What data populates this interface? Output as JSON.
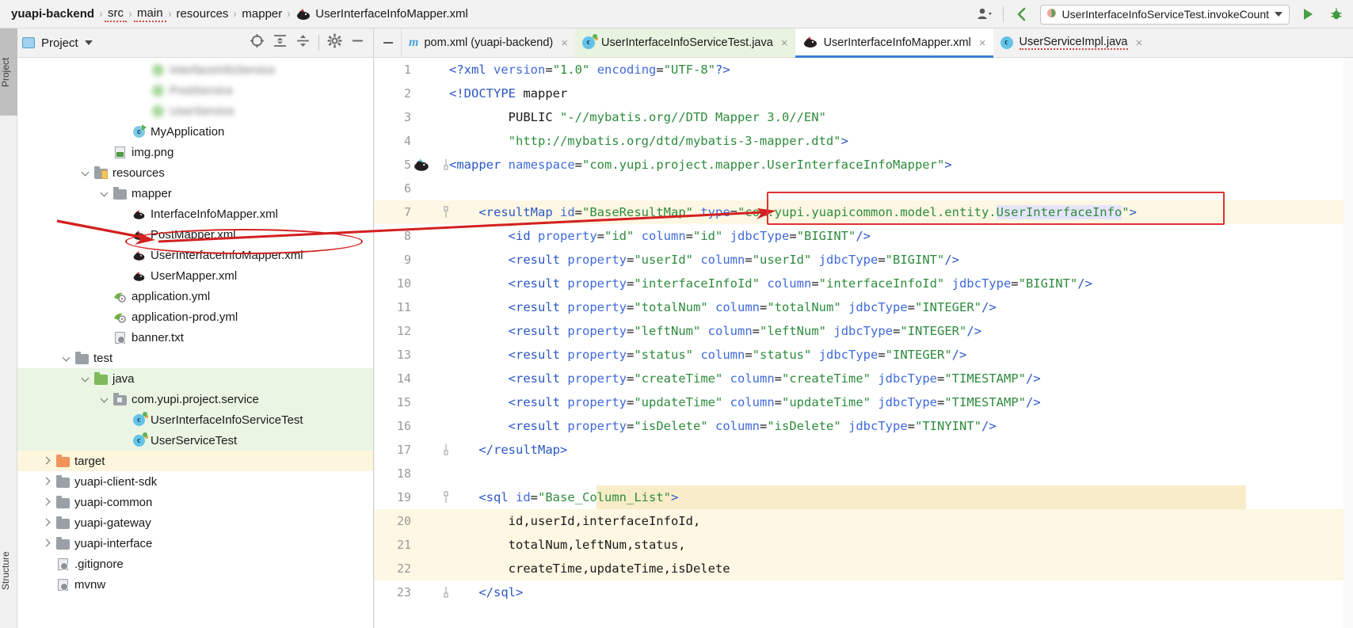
{
  "window": {
    "breadcrumb": [
      {
        "label": "yuapi-backend",
        "bold": true,
        "underline": false,
        "icon": null
      },
      {
        "label": "src",
        "bold": false,
        "underline": true,
        "icon": null
      },
      {
        "label": "main",
        "bold": false,
        "underline": true,
        "icon": null
      },
      {
        "label": "resources",
        "bold": false,
        "underline": false,
        "icon": null
      },
      {
        "label": "mapper",
        "bold": false,
        "underline": false,
        "icon": null
      },
      {
        "label": "UserInterfaceInfoMapper.xml",
        "bold": false,
        "underline": false,
        "icon": "mybatis-xml-icon"
      }
    ],
    "separator": "›",
    "toolbar_right": {
      "account_icon": "user-account-icon",
      "back_icon": "back-arrow-icon",
      "run_configuration": "UserInterfaceInfoServiceTest.invokeCount",
      "run_config_icon": "run-config-icon",
      "dropdown_icon": "chevron-down-icon",
      "run_icon": "run-play-icon",
      "debug_icon": "debug-bug-icon"
    }
  },
  "left_strip": {
    "project_tab": "Project",
    "structure_tab": "Structure"
  },
  "project_panel": {
    "title": "Project",
    "title_icon": "project-window-icon",
    "dropdown_icon": "chevron-down-icon",
    "tools": [
      {
        "name": "locate-file-icon",
        "glyph": "target"
      },
      {
        "name": "expand-all-icon",
        "glyph": "expand"
      },
      {
        "name": "collapse-all-icon",
        "glyph": "collapse"
      },
      {
        "name": "settings-gear-icon",
        "glyph": "gear"
      },
      {
        "name": "hide-panel-icon",
        "glyph": "minus"
      }
    ],
    "tree": [
      {
        "label": "InterfaceInfoService",
        "icon": "interface-icon",
        "indent": 6,
        "arrow": "none",
        "blurred": true,
        "highlight": "none"
      },
      {
        "label": "PostService",
        "icon": "interface-icon",
        "indent": 6,
        "arrow": "none",
        "blurred": true,
        "highlight": "none"
      },
      {
        "label": "UserService",
        "icon": "interface-icon",
        "indent": 6,
        "arrow": "none",
        "blurred": true,
        "highlight": "none"
      },
      {
        "label": "MyApplication",
        "icon": "spring-class-icon",
        "indent": 5,
        "arrow": "none",
        "blurred": false,
        "highlight": "none"
      },
      {
        "label": "img.png",
        "icon": "image-file-icon",
        "indent": 4,
        "arrow": "none",
        "blurred": false,
        "highlight": "none"
      },
      {
        "label": "resources",
        "icon": "resources-folder-icon",
        "indent": 3,
        "arrow": "down",
        "blurred": false,
        "highlight": "none"
      },
      {
        "label": "mapper",
        "icon": "folder-icon",
        "indent": 4,
        "arrow": "down",
        "blurred": false,
        "highlight": "none"
      },
      {
        "label": "InterfaceInfoMapper.xml",
        "icon": "mybatis-xml-icon",
        "indent": 5,
        "arrow": "none",
        "blurred": false,
        "highlight": "none"
      },
      {
        "label": "PostMapper.xml",
        "icon": "mybatis-xml-icon",
        "indent": 5,
        "arrow": "none",
        "blurred": false,
        "highlight": "none"
      },
      {
        "label": "UserInterfaceInfoMapper.xml",
        "icon": "mybatis-xml-icon",
        "indent": 5,
        "arrow": "none",
        "blurred": false,
        "highlight": "none"
      },
      {
        "label": "UserMapper.xml",
        "icon": "mybatis-xml-icon",
        "indent": 5,
        "arrow": "none",
        "blurred": false,
        "highlight": "none"
      },
      {
        "label": "application.yml",
        "icon": "spring-yml-icon",
        "indent": 4,
        "arrow": "none",
        "blurred": false,
        "highlight": "none"
      },
      {
        "label": "application-prod.yml",
        "icon": "spring-yml-icon",
        "indent": 4,
        "arrow": "none",
        "blurred": false,
        "highlight": "none"
      },
      {
        "label": "banner.txt",
        "icon": "text-file-icon",
        "indent": 4,
        "arrow": "none",
        "blurred": false,
        "highlight": "none"
      },
      {
        "label": "test",
        "icon": "folder-icon",
        "indent": 2,
        "arrow": "down",
        "blurred": false,
        "highlight": "none"
      },
      {
        "label": "java",
        "icon": "source-folder-icon",
        "indent": 3,
        "arrow": "down",
        "blurred": false,
        "highlight": "green"
      },
      {
        "label": "com.yupi.project.service",
        "icon": "package-folder-icon",
        "indent": 4,
        "arrow": "down",
        "blurred": false,
        "highlight": "green"
      },
      {
        "label": "UserInterfaceInfoServiceTest",
        "icon": "test-class-icon",
        "indent": 5,
        "arrow": "none",
        "blurred": false,
        "highlight": "green"
      },
      {
        "label": "UserServiceTest",
        "icon": "test-class-icon",
        "indent": 5,
        "arrow": "none",
        "blurred": false,
        "highlight": "green"
      },
      {
        "label": "target",
        "icon": "target-folder-icon",
        "indent": 1,
        "arrow": "right",
        "blurred": false,
        "highlight": "yellow"
      },
      {
        "label": "yuapi-client-sdk",
        "icon": "folder-icon",
        "indent": 1,
        "arrow": "right",
        "blurred": false,
        "highlight": "none"
      },
      {
        "label": "yuapi-common",
        "icon": "folder-icon",
        "indent": 1,
        "arrow": "right",
        "blurred": false,
        "highlight": "none"
      },
      {
        "label": "yuapi-gateway",
        "icon": "folder-icon",
        "indent": 1,
        "arrow": "right",
        "blurred": false,
        "highlight": "none"
      },
      {
        "label": "yuapi-interface",
        "icon": "folder-icon",
        "indent": 1,
        "arrow": "right",
        "blurred": false,
        "highlight": "none"
      },
      {
        "label": ".gitignore",
        "icon": "gitignore-file-icon",
        "indent": 1,
        "arrow": "none",
        "blurred": false,
        "highlight": "none"
      },
      {
        "label": "mvnw",
        "icon": "text-file-icon",
        "indent": 1,
        "arrow": "none",
        "blurred": false,
        "highlight": "none"
      }
    ]
  },
  "editor_tabs": {
    "hide_label": "—",
    "tabs": [
      {
        "label": "pom.xml (yuapi-backend)",
        "icon": "maven-m-icon",
        "state": "inactive",
        "close": "×",
        "squiggle": false
      },
      {
        "label": "UserInterfaceInfoServiceTest.java",
        "icon": "test-class-icon",
        "state": "context-green",
        "close": "×",
        "squiggle": false
      },
      {
        "label": "UserInterfaceInfoMapper.xml",
        "icon": "mybatis-xml-icon",
        "state": "active",
        "close": "×",
        "squiggle": false
      },
      {
        "label": "UserServiceImpl.java",
        "icon": "java-class-icon",
        "state": "inactive",
        "close": "×",
        "squiggle": true
      }
    ]
  },
  "code": {
    "file_language": "xml",
    "lines": [
      {
        "n": "1",
        "text": "<?xml version=\"1.0\" encoding=\"UTF-8\"?>",
        "band": "none"
      },
      {
        "n": "2",
        "text": "<!DOCTYPE mapper",
        "band": "none"
      },
      {
        "n": "3",
        "text": "        PUBLIC \"-//mybatis.org//DTD Mapper 3.0//EN\"",
        "band": "none"
      },
      {
        "n": "4",
        "text": "        \"http://mybatis.org/dtd/mybatis-3-mapper.dtd\">",
        "band": "none"
      },
      {
        "n": "5",
        "text": "<mapper namespace=\"com.yupi.project.mapper.UserInterfaceInfoMapper\">",
        "band": "none"
      },
      {
        "n": "6",
        "text": "",
        "band": "none"
      },
      {
        "n": "7",
        "text": "    <resultMap id=\"BaseResultMap\" type=\"com.yupi.yuapicommon.model.entity.UserInterfaceInfo\">",
        "band": "yellow"
      },
      {
        "n": "8",
        "text": "        <id property=\"id\" column=\"id\" jdbcType=\"BIGINT\"/>",
        "band": "none"
      },
      {
        "n": "9",
        "text": "        <result property=\"userId\" column=\"userId\" jdbcType=\"BIGINT\"/>",
        "band": "none"
      },
      {
        "n": "10",
        "text": "        <result property=\"interfaceInfoId\" column=\"interfaceInfoId\" jdbcType=\"BIGINT\"/>",
        "band": "none"
      },
      {
        "n": "11",
        "text": "        <result property=\"totalNum\" column=\"totalNum\" jdbcType=\"INTEGER\"/>",
        "band": "none"
      },
      {
        "n": "12",
        "text": "        <result property=\"leftNum\" column=\"leftNum\" jdbcType=\"INTEGER\"/>",
        "band": "none"
      },
      {
        "n": "13",
        "text": "        <result property=\"status\" column=\"status\" jdbcType=\"INTEGER\"/>",
        "band": "none"
      },
      {
        "n": "14",
        "text": "        <result property=\"createTime\" column=\"createTime\" jdbcType=\"TIMESTAMP\"/>",
        "band": "none"
      },
      {
        "n": "15",
        "text": "        <result property=\"updateTime\" column=\"updateTime\" jdbcType=\"TIMESTAMP\"/>",
        "band": "none"
      },
      {
        "n": "16",
        "text": "        <result property=\"isDelete\" column=\"isDelete\" jdbcType=\"TINYINT\"/>",
        "band": "none"
      },
      {
        "n": "17",
        "text": "    </resultMap>",
        "band": "none"
      },
      {
        "n": "18",
        "text": "",
        "band": "none"
      },
      {
        "n": "19",
        "text": "    <sql id=\"Base_Column_List\">",
        "band": "yellow-right"
      },
      {
        "n": "20",
        "text": "        id,userId,interfaceInfoId,",
        "band": "yellow"
      },
      {
        "n": "21",
        "text": "        totalNum,leftNum,status,",
        "band": "yellow"
      },
      {
        "n": "22",
        "text": "        createTime,updateTime,isDelete",
        "band": "yellow"
      },
      {
        "n": "23",
        "text": "    </sql>",
        "band": "none"
      }
    ],
    "selected_token": "UserInterfaceInfo",
    "gutter_icons": [
      {
        "line": "5",
        "icon": "mybatis-mapper-gutter-icon"
      }
    ]
  },
  "annotations": {
    "arrow_to_tree_color": "#d32020",
    "ellipse_target": "UserInterfaceInfoMapper.xml",
    "box_target": "com.yupi.yuapicommon.model.entity.UserInterfaceInfo",
    "box_color": "#e03131"
  },
  "colors": {
    "accent_blue": "#3b7fd4",
    "tab_active_bg": "#ffffff",
    "context_green": "#e8f3e0",
    "highlight_yellow": "#fdf7e3",
    "annotation_red": "#e03131",
    "string_green": "#2e8b3d",
    "tag_blue": "#2b57c4"
  }
}
